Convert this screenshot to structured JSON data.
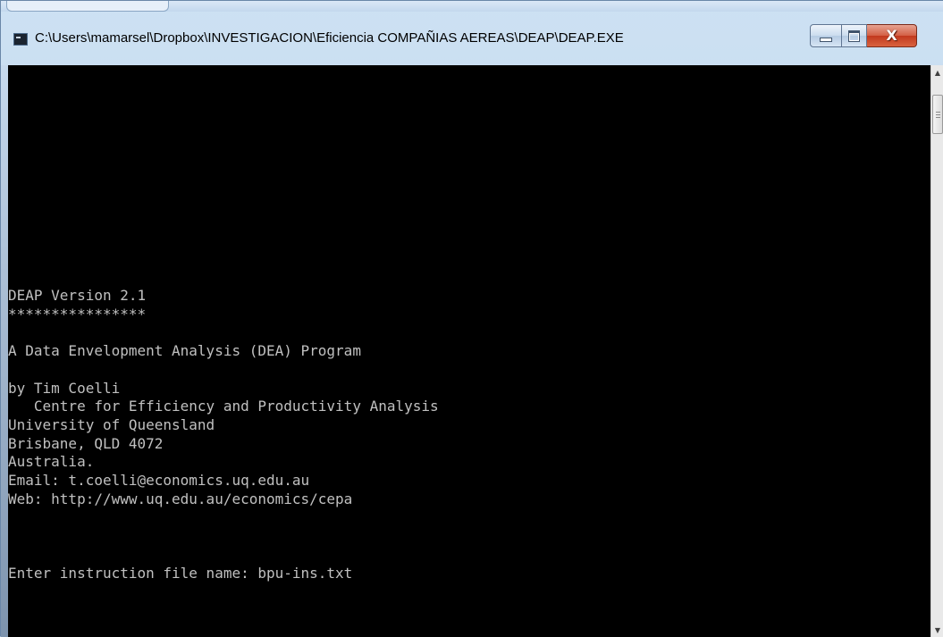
{
  "window": {
    "title": "C:\\Users\\mamarsel\\Dropbox\\INVESTIGACION\\Eficiencia COMPAÑIAS AEREAS\\DEAP\\DEAP.EXE",
    "close_glyph": "X",
    "app_icon": "console-icon"
  },
  "scrollbar": {
    "up_glyph": "▲",
    "down_glyph": "▼"
  },
  "console": {
    "text_color": "#c0c0c0",
    "background": "#000000",
    "lines": [
      "",
      "",
      "",
      "",
      "",
      "",
      "",
      "",
      "",
      "",
      "",
      "",
      "DEAP Version 2.1",
      "****************",
      "",
      "A Data Envelopment Analysis (DEA) Program",
      "",
      "by Tim Coelli",
      "   Centre for Efficiency and Productivity Analysis",
      "University of Queensland",
      "Brisbane, QLD 4072",
      "Australia.",
      "Email: t.coelli@economics.uq.edu.au",
      "Web: http://www.uq.edu.au/economics/cepa",
      "",
      "",
      "",
      "Enter instruction file name: bpu-ins.txt"
    ]
  }
}
